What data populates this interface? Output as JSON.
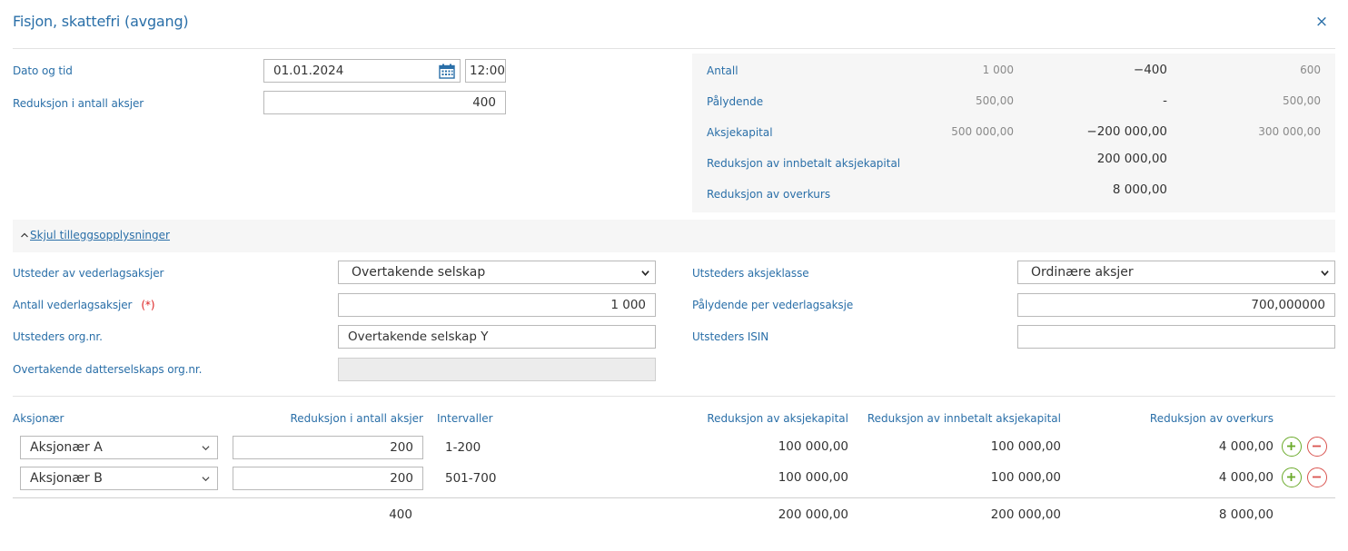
{
  "dialog": {
    "title": "Fisjon, skattefri (avgang)",
    "close": "×"
  },
  "form": {
    "date_time_label": "Dato og tid",
    "date_value": "01.01.2024",
    "time_value": "12:00",
    "reduction_label": "Reduksjon i antall aksjer",
    "reduction_value": "400"
  },
  "summary": {
    "rows": [
      {
        "label": "Antall",
        "before": "1 000",
        "change": "−400",
        "after": "600"
      },
      {
        "label": "Pålydende",
        "before": "500,00",
        "change": "-",
        "after": "500,00"
      },
      {
        "label": "Aksjekapital",
        "before": "500 000,00",
        "change": "−200 000,00",
        "after": "300 000,00"
      },
      {
        "label": "Reduksjon av innbetalt aksjekapital",
        "change": "200 000,00"
      },
      {
        "label": "Reduksjon av overkurs",
        "change": "8 000,00"
      }
    ]
  },
  "toggle": {
    "arrow": "^",
    "label": "Skjul tilleggsopplysninger"
  },
  "extra": {
    "issuer_label": "Utsteder av vederlagsaksjer",
    "issuer_value": "Overtakende selskap",
    "share_class_label": "Utsteders aksjeklasse",
    "share_class_value": "Ordinære aksjer",
    "count_label": "Antall vederlagsaksjer",
    "count_required": "(*)",
    "count_value": "1 000",
    "nominal_label": "Pålydende per vederlagsaksje",
    "nominal_value": "700,000000",
    "orgnr_label": "Utsteders org.nr.",
    "orgnr_value": "Overtakende selskap Y",
    "isin_label": "Utsteders ISIN",
    "isin_value": "",
    "subsidiary_label": "Overtakende datterselskaps org.nr.",
    "subsidiary_value": ""
  },
  "table": {
    "headers": {
      "shareholder": "Aksjonær",
      "reduction_count": "Reduksjon i antall aksjer",
      "intervals": "Intervaller",
      "reduction_capital": "Reduksjon av aksjekapital",
      "reduction_paid": "Reduksjon av innbetalt aksjekapital",
      "reduction_premium": "Reduksjon av overkurs"
    },
    "rows": [
      {
        "shareholder": "Aksjonær A",
        "count": "200",
        "interval": "1-200",
        "capital": "100 000,00",
        "paid": "100 000,00",
        "premium": "4 000,00"
      },
      {
        "shareholder": "Aksjonær B",
        "count": "200",
        "interval": "501-700",
        "capital": "100 000,00",
        "paid": "100 000,00",
        "premium": "4 000,00"
      }
    ],
    "totals": {
      "count": "400",
      "capital": "200 000,00",
      "paid": "200 000,00",
      "premium": "8 000,00"
    }
  },
  "colors": {
    "accent": "#2a6fa8",
    "add": "#6aaa2a",
    "remove": "#d9534f"
  },
  "icons": {
    "calendar": "calendar-icon",
    "chevron": "chevron-down-icon",
    "add": "plus-circle-icon",
    "remove": "minus-circle-icon",
    "close": "close-icon"
  }
}
